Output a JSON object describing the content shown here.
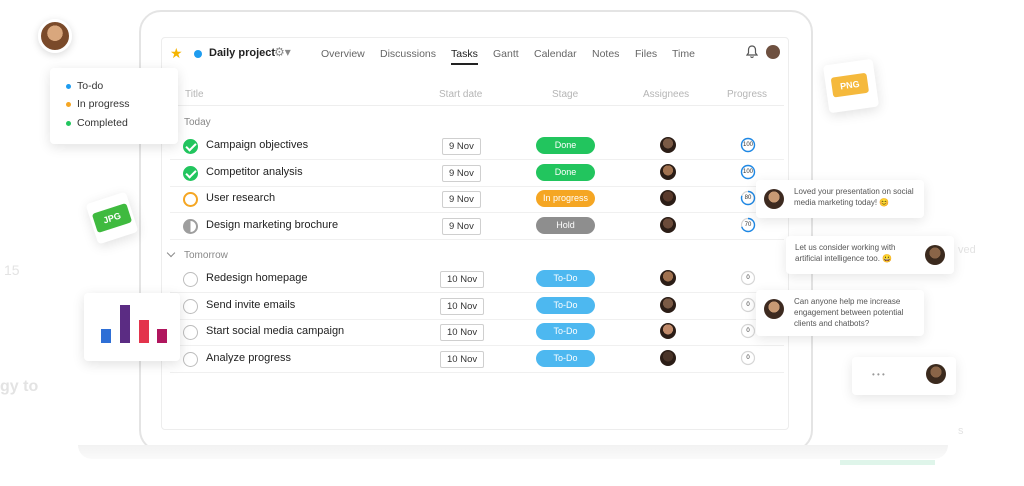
{
  "background_ghost": {
    "left_top": "15",
    "left_mid": "gy to",
    "right_top": "ved",
    "right_bottom": "s"
  },
  "legend": {
    "items": [
      {
        "label": "To-do",
        "color": "#1e9cef"
      },
      {
        "label": "In progress",
        "color": "#f5a623"
      },
      {
        "label": "Completed",
        "color": "#22c55e"
      }
    ]
  },
  "file_tags": {
    "jpg": "JPG",
    "png": "PNG"
  },
  "header": {
    "project_name": "Daily project",
    "tabs": [
      "Overview",
      "Discussions",
      "Tasks",
      "Gantt",
      "Calendar",
      "Notes",
      "Files",
      "Time"
    ],
    "active_tab": "Tasks"
  },
  "table": {
    "columns": [
      "Title",
      "Start date",
      "Stage",
      "Assignees",
      "Progress"
    ],
    "sections": [
      {
        "label": "Today",
        "rows": [
          {
            "title": "Campaign objectives",
            "date": "9 Nov",
            "stage": "Done",
            "stage_color": "#22c55e",
            "status": "done",
            "progress": "100"
          },
          {
            "title": "Competitor analysis",
            "date": "9 Nov",
            "stage": "Done",
            "stage_color": "#22c55e",
            "status": "done",
            "progress": "100"
          },
          {
            "title": "User research",
            "date": "9 Nov",
            "stage": "In progress",
            "stage_color": "#f5a623",
            "status": "progress",
            "progress": "80"
          },
          {
            "title": "Design marketing brochure",
            "date": "9 Nov",
            "stage": "Hold",
            "stage_color": "#8e8e8e",
            "status": "hold",
            "progress": "70"
          }
        ]
      },
      {
        "label": "Tomorrow",
        "rows": [
          {
            "title": "Redesign homepage",
            "date": "10 Nov",
            "stage": "To-Do",
            "stage_color": "#4db8f0",
            "status": "todo",
            "progress": "0"
          },
          {
            "title": "Send invite emails",
            "date": "10 Nov",
            "stage": "To-Do",
            "stage_color": "#4db8f0",
            "status": "todo",
            "progress": "0"
          },
          {
            "title": "Start social media campaign",
            "date": "10 Nov",
            "stage": "To-Do",
            "stage_color": "#4db8f0",
            "status": "todo",
            "progress": "0"
          },
          {
            "title": "Analyze progress",
            "date": "10 Nov",
            "stage": "To-Do",
            "stage_color": "#4db8f0",
            "status": "todo",
            "progress": "0"
          }
        ]
      }
    ]
  },
  "chats": [
    {
      "text": "Loved your presentation on social media marketing today! 😊"
    },
    {
      "text": "Let us consider working with artificial intelligence too. 😀"
    },
    {
      "text": "Can anyone help me increase engagement between potential clients and chatbots?"
    },
    {
      "text": "• • •"
    }
  ],
  "mini_chart": {
    "bars": [
      {
        "value": 0.38,
        "color": "#2e6fd6"
      },
      {
        "value": 1.0,
        "color": "#5b2c83"
      },
      {
        "value": 0.6,
        "color": "#e3344c"
      },
      {
        "value": 0.38,
        "color": "#b0165e"
      }
    ]
  }
}
